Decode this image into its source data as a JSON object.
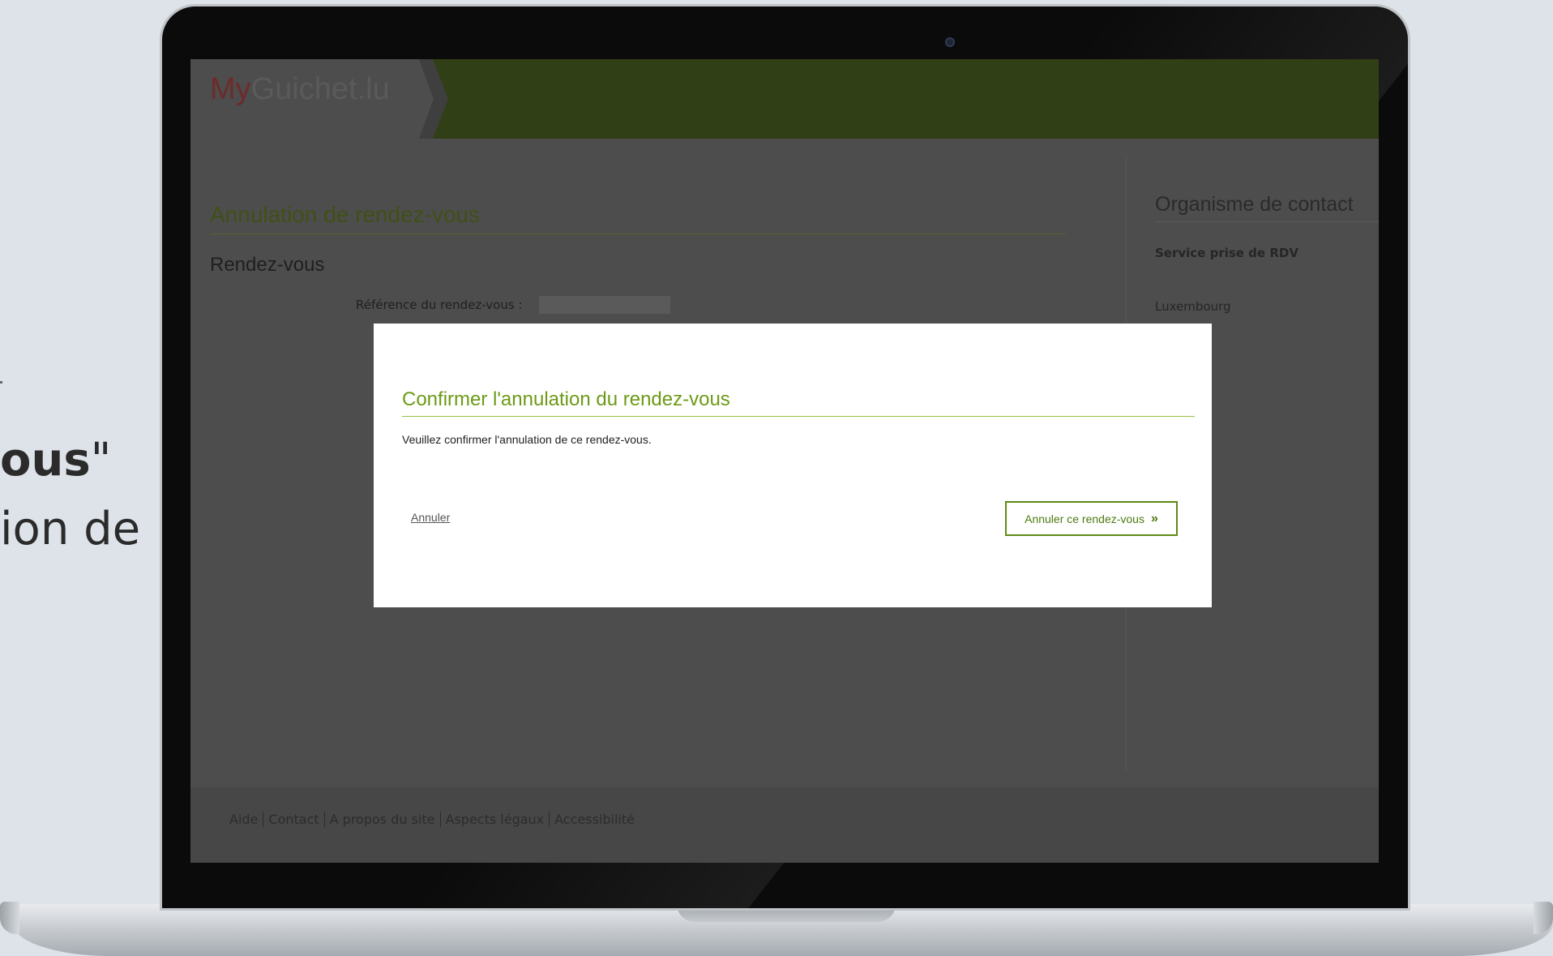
{
  "side_caption": {
    "line1_bold": "ous",
    "line1_tail": "\"",
    "line2": "ion de"
  },
  "site": {
    "logo_my": "My",
    "logo_rest": "Guichet.lu",
    "page_title": "Annulation de rendez-vous",
    "section_title": "Rendez-vous",
    "reference_label": "Référence du rendez-vous :",
    "aside": {
      "title": "Organisme de contact",
      "service": "Service prise de RDV",
      "city": "Luxembourg"
    },
    "footer_links": [
      "Aide",
      "Contact",
      "A propos du site",
      "Aspects légaux",
      "Accessibilité"
    ]
  },
  "modal": {
    "title": "Confirmer l'annulation du rendez-vous",
    "message": "Veuillez confirmer l'annulation de ce rendez-vous.",
    "cancel_label": "Annuler",
    "confirm_label": "Annuler ce rendez-vous",
    "confirm_icon": "double-chevron-right-icon"
  },
  "colors": {
    "header_green": "#313f16",
    "accent_green": "#6d9a16",
    "logo_red": "#6e2a2a"
  }
}
